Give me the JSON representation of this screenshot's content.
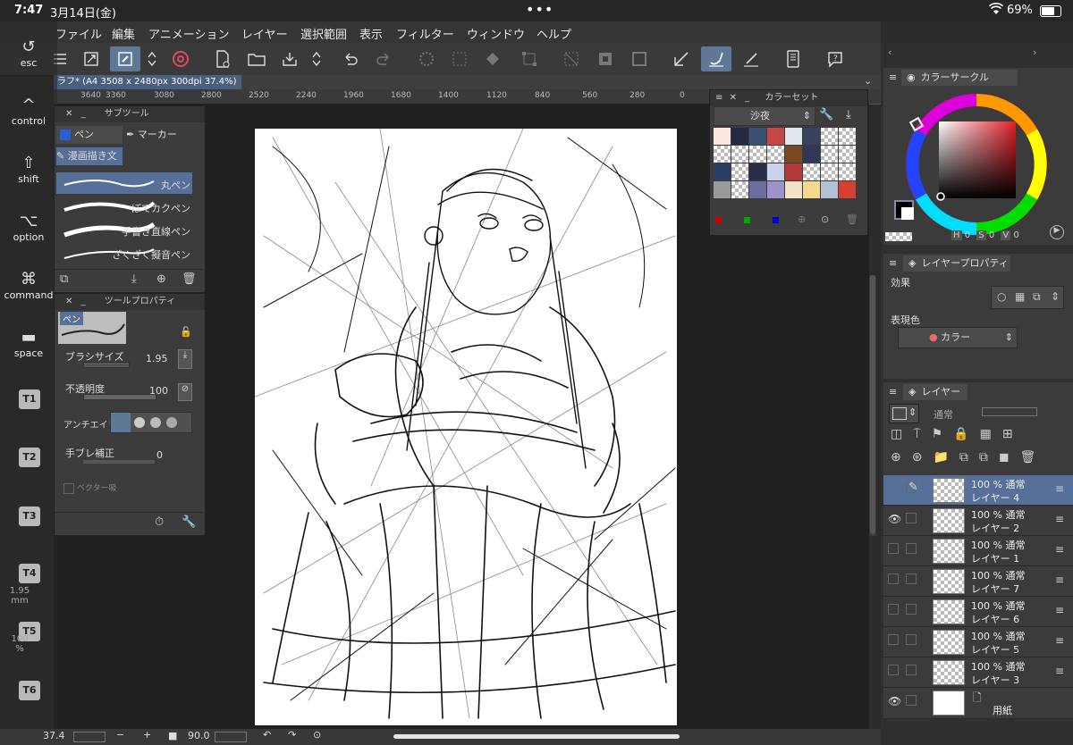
{
  "status": {
    "time": "7:47",
    "date": "3月14日(金)",
    "battery": "69%"
  },
  "menu": [
    "ファイル",
    "編集",
    "アニメーション",
    "レイヤー",
    "選択範囲",
    "表示",
    "フィルター",
    "ウィンドウ",
    "ヘルプ"
  ],
  "document": {
    "tab_label": "ラフ* (A4 3508 x 2480px 300dpi 37.4%)"
  },
  "ruler": [
    "3640",
    "3360",
    "3080",
    "2800",
    "2520",
    "2240",
    "1960",
    "1680",
    "1400",
    "1120",
    "840",
    "560",
    "280",
    "0"
  ],
  "modifiers": [
    {
      "label": "esc",
      "icon": "↺"
    },
    {
      "label": "control",
      "icon": "^"
    },
    {
      "label": "shift",
      "icon": "⇧"
    },
    {
      "label": "option",
      "icon": "⌥"
    },
    {
      "label": "command",
      "icon": "⌘"
    },
    {
      "label": "space",
      "icon": "▬"
    }
  ],
  "tkeys": [
    "T1",
    "T2",
    "T3",
    "T4",
    "T5",
    "T6"
  ],
  "left_side_readouts": {
    "size": "1.95",
    "unit": "mm",
    "percent": "100",
    "percent_unit": "%"
  },
  "subtool": {
    "title": "サブツール",
    "tab_pen": "ペン",
    "tab_marker": "マーカー",
    "group": "漫画描き文",
    "brushes": [
      "丸ペン",
      "ぼてカクペン",
      "手書き直線ペン",
      "ざくざく擬音ペン"
    ]
  },
  "toolprop": {
    "title": "ツールプロパティ",
    "tool": "ペン",
    "brush_size_label": "ブラシサイズ",
    "brush_size": "1.95",
    "opacity_label": "不透明度",
    "opacity": "100",
    "antialias_label": "アンチエイリ",
    "stabilization_label": "手ブレ補正",
    "stabilization": "0",
    "vector_label": "ベクター吸"
  },
  "colorset": {
    "title": "カラーセット",
    "set_name": "沙夜"
  },
  "colorcircle": {
    "title": "カラーサークル",
    "h_label": "H",
    "h": "0",
    "s_label": "S",
    "s": "0",
    "v_label": "V",
    "v": "0"
  },
  "layerprop": {
    "title": "レイヤープロパティ",
    "effect_label": "効果",
    "expression_label": "表現色",
    "expression": "カラー"
  },
  "layers": {
    "title": "レイヤー",
    "blend": "通常",
    "items": [
      {
        "opacity": "100 %",
        "mode": "通常",
        "name": "レイヤー 4",
        "selected": true,
        "visible": false
      },
      {
        "opacity": "100 %",
        "mode": "通常",
        "name": "レイヤー 2",
        "selected": false,
        "visible": true
      },
      {
        "opacity": "100 %",
        "mode": "通常",
        "name": "レイヤー 1",
        "selected": false,
        "visible": false
      },
      {
        "opacity": "100 %",
        "mode": "通常",
        "name": "レイヤー 7",
        "selected": false,
        "visible": false
      },
      {
        "opacity": "100 %",
        "mode": "通常",
        "name": "レイヤー 6",
        "selected": false,
        "visible": false
      },
      {
        "opacity": "100 %",
        "mode": "通常",
        "name": "レイヤー 5",
        "selected": false,
        "visible": false
      },
      {
        "opacity": "100 %",
        "mode": "通常",
        "name": "レイヤー 3",
        "selected": false,
        "visible": false
      }
    ],
    "paper": {
      "name": "用紙",
      "visible": true
    }
  },
  "bottom": {
    "zoom_value": "37.4",
    "angle": "90.0"
  }
}
